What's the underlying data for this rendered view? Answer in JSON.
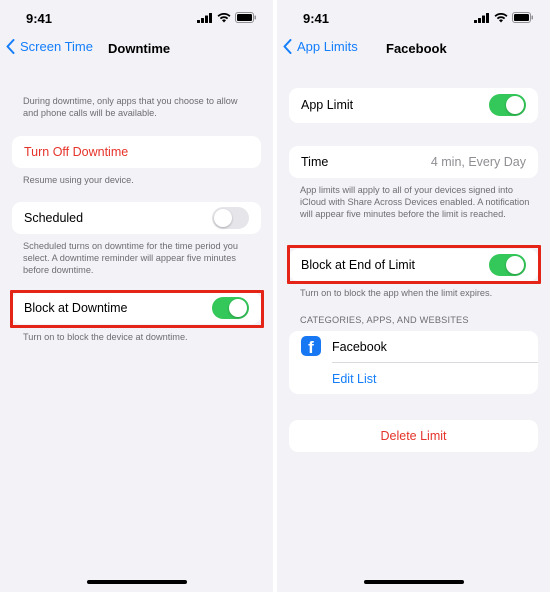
{
  "status_bar": {
    "time": "9:41",
    "icons": [
      "signal-icon",
      "wifi-icon",
      "battery-icon"
    ]
  },
  "left": {
    "nav": {
      "back_label": "Screen Time",
      "title": "Downtime"
    },
    "intro": "During downtime, only apps that you choose to allow and phone calls will be available.",
    "turn_off": {
      "label": "Turn Off Downtime",
      "note": "Resume using your device."
    },
    "scheduled": {
      "label": "Scheduled",
      "toggle_on": false,
      "note": "Scheduled turns on downtime for the time period you select. A downtime reminder will appear five minutes before downtime."
    },
    "block": {
      "label": "Block at Downtime",
      "toggle_on": true,
      "note": "Turn on to block the device at downtime."
    }
  },
  "right": {
    "nav": {
      "back_label": "App Limits",
      "title": "Facebook"
    },
    "app_limit": {
      "label": "App Limit",
      "toggle_on": true
    },
    "time": {
      "label": "Time",
      "value": "4 min, Every Day",
      "note": "App limits will apply to all of your devices signed into iCloud with Share Across Devices enabled. A notification will appear five minutes before the limit is reached."
    },
    "block_end": {
      "label": "Block at End of Limit",
      "toggle_on": true,
      "note": "Turn on to block the app when the limit expires."
    },
    "categories": {
      "header": "CATEGORIES, APPS, AND WEBSITES",
      "app_name": "Facebook",
      "edit_label": "Edit List"
    },
    "delete_label": "Delete Limit"
  },
  "colors": {
    "accent": "#147efb",
    "destructive": "#e5332a",
    "toggle_on": "#34c759",
    "highlight": "#e32416"
  }
}
